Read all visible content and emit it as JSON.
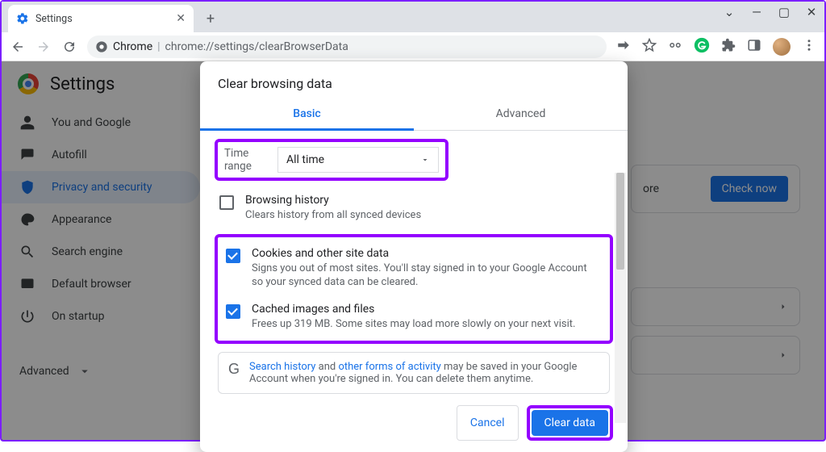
{
  "window": {
    "tab_title": "Settings",
    "controls": {
      "caret": "⌄",
      "min": "—",
      "max": "▢",
      "close": "✕"
    },
    "newtab": "+"
  },
  "addrbar": {
    "chrome_label": "Chrome",
    "url_path": "chrome://settings/clearBrowserData"
  },
  "header": {
    "title": "Settings"
  },
  "sidebar": {
    "items": [
      {
        "label": "You and Google"
      },
      {
        "label": "Autofill"
      },
      {
        "label": "Privacy and security"
      },
      {
        "label": "Appearance"
      },
      {
        "label": "Search engine"
      },
      {
        "label": "Default browser"
      },
      {
        "label": "On startup"
      }
    ],
    "advanced": "Advanced"
  },
  "rightpanel": {
    "partial_text": "ore",
    "check_now": "Check now"
  },
  "dialog": {
    "title": "Clear browsing data",
    "tabs": {
      "basic": "Basic",
      "advanced": "Advanced"
    },
    "time_range_label": "Time range",
    "time_range_value": "All time",
    "items": [
      {
        "title": "Browsing history",
        "desc": "Clears history from all synced devices",
        "checked": false
      },
      {
        "title": "Cookies and other site data",
        "desc": "Signs you out of most sites. You'll stay signed in to your Google Account so your synced data can be cleared.",
        "checked": true
      },
      {
        "title": "Cached images and files",
        "desc": "Frees up 319 MB. Some sites may load more slowly on your next visit.",
        "checked": true
      }
    ],
    "info": {
      "link1": "Search history",
      "mid1": " and ",
      "link2": "other forms of activity",
      "rest": " may be saved in your Google Account when you're signed in. You can delete them anytime."
    },
    "cancel": "Cancel",
    "clear": "Clear data"
  }
}
